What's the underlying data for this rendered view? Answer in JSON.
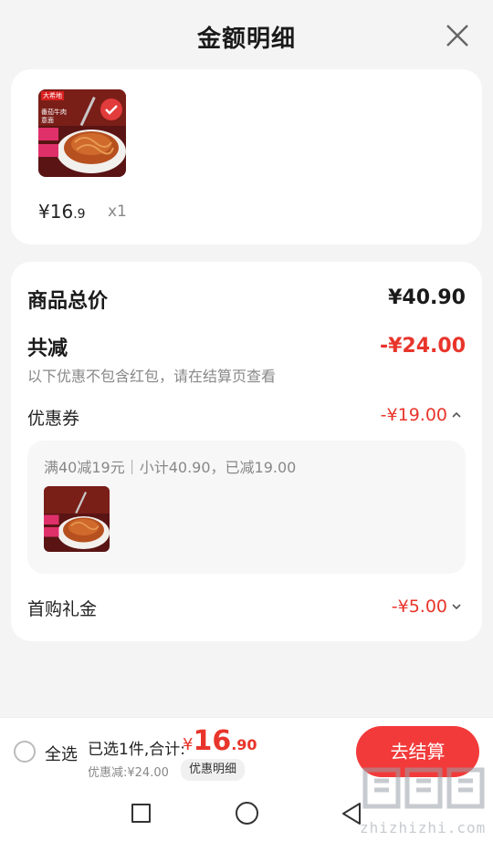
{
  "header": {
    "title": "金额明细"
  },
  "product": {
    "price_int": "¥16",
    "price_dec": ".9",
    "qty": "x1"
  },
  "summary": {
    "total_label": "商品总价",
    "total_value": "¥40.90",
    "reduce_label": "共减",
    "reduce_value": "-¥24.00",
    "note": "以下优惠不包含红包，请在结算页查看",
    "coupon_label": "优惠券",
    "coupon_value": "-¥19.00",
    "coupon_desc": "满40减19元｜小计40.90，已减19.00",
    "gift_label": "首购礼金",
    "gift_value": "-¥5.00"
  },
  "thumb_text": {
    "brand": "大希地",
    "line1": "番茄牛肉",
    "line2": "意面"
  },
  "footer": {
    "select_all": "全选",
    "selected_text": "已选1件,合计:",
    "total_yen": "¥",
    "total_int": "16",
    "total_dec": ".90",
    "discount": "优惠减:¥24.00",
    "detail_button": "优惠明细",
    "checkout": "去结算"
  },
  "watermark": {
    "text": "zhizhizhi.com"
  },
  "colors": {
    "accent": "#e8352b",
    "button": "#f23a3a"
  }
}
